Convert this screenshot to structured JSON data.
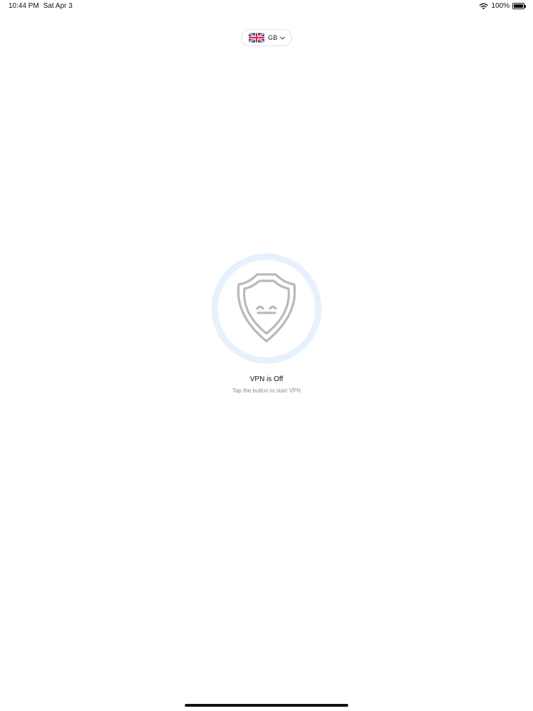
{
  "status_bar": {
    "time": "10:44 PM",
    "date": "Sat Apr 3",
    "battery_text": "100%",
    "battery_level": 1.0,
    "wifi_icon": "wifi-icon",
    "battery_icon": "battery-icon"
  },
  "country": {
    "code": "GB",
    "flag_icon": "uk-flag-icon",
    "dropdown_icon": "chevron-down-icon"
  },
  "vpn": {
    "status": "VPN is Off",
    "hint": "Tap the button to start VPN",
    "toggle_icon": "shield-face-icon"
  },
  "colors": {
    "ring": "#e6f1fd",
    "shield_stroke": "#b9b9bd",
    "hint_text": "#8e8e93"
  }
}
